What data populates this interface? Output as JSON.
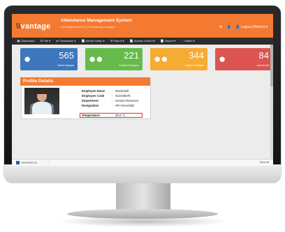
{
  "app": {
    "logo_mark": "\\\\",
    "logo_text": "vantage",
    "title": "Attendance Management System",
    "subtitle": "(All Rights Reserved | Powered by Vantage)",
    "header_links": [
      "⚙",
      "👤",
      "👤 Logout (Admin) ▾"
    ]
  },
  "nav": {
    "items": [
      "🏠 Dashboard",
      "☰ File ▾",
      "⇄ Transaction ▾",
      "📄 Device Setup ▾",
      "☰ Payroll ▾",
      "📄 Access Control ▾",
      "📄 Report ▾",
      "⋮ Admin ▾"
    ]
  },
  "stats": [
    {
      "value": "565",
      "label": "Total Employee",
      "icon": "user-icon",
      "color": "#3d77bd"
    },
    {
      "value": "221",
      "label": "Present Employee",
      "icon": "group-icon",
      "color": "#66bb4a"
    },
    {
      "value": "344",
      "label": "Absent Employee",
      "icon": "group-icon",
      "color": "#f6ab32"
    },
    {
      "value": "84",
      "label": "Late Arrival",
      "icon": "user-icon",
      "color": "#dc5550"
    }
  ],
  "profile": {
    "heading": "Profile Details",
    "fields": [
      {
        "label": "Employee Name",
        "value": "David Bell"
      },
      {
        "label": "Employee Code",
        "value": "012345678"
      },
      {
        "label": "Department",
        "value": "Human Resource"
      },
      {
        "label": "Designation",
        "value": "HR Generalist"
      }
    ],
    "temperature": {
      "label": "Temperature",
      "value": "36.8 °C"
    }
  },
  "status_bar": {
    "download_name": "Userdetails.zip",
    "download_menu": "^",
    "show_all": "Show all"
  }
}
